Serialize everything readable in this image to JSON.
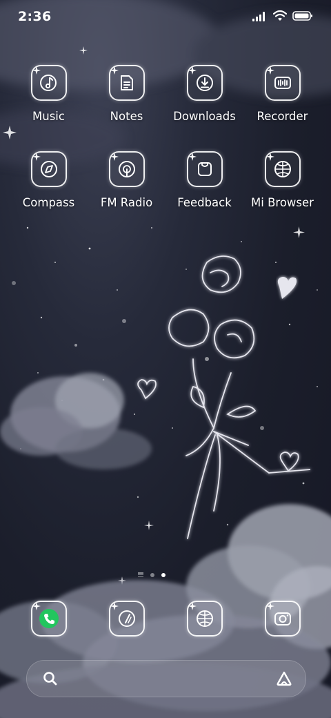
{
  "status_bar": {
    "time": "2:36",
    "icons": [
      "signal-icon",
      "wifi-icon",
      "battery-icon"
    ]
  },
  "home_apps": [
    {
      "label": "Music",
      "icon": "music-note-icon"
    },
    {
      "label": "Notes",
      "icon": "notes-icon"
    },
    {
      "label": "Downloads",
      "icon": "download-icon"
    },
    {
      "label": "Recorder",
      "icon": "recorder-icon"
    },
    {
      "label": "Compass",
      "icon": "compass-icon"
    },
    {
      "label": "FM Radio",
      "icon": "radio-icon"
    },
    {
      "label": "Feedback",
      "icon": "feedback-icon"
    },
    {
      "label": "Mi Browser",
      "icon": "browser-globe-icon"
    }
  ],
  "page_indicator": {
    "pages": 2,
    "active": 2
  },
  "dock": [
    {
      "name": "phone",
      "icon": "phone-icon",
      "color": "#22c55e"
    },
    {
      "name": "compass-alt",
      "icon": "compass-icon"
    },
    {
      "name": "browser",
      "icon": "browser-globe-icon"
    },
    {
      "name": "camera",
      "icon": "camera-icon"
    }
  ],
  "search_bar": {
    "left_icon": "search-icon",
    "right_icon": "assistant-icon"
  },
  "colors": {
    "icon_outline": "#ffffff",
    "phone_green": "#22c55e",
    "background": "#1b1e2c"
  }
}
